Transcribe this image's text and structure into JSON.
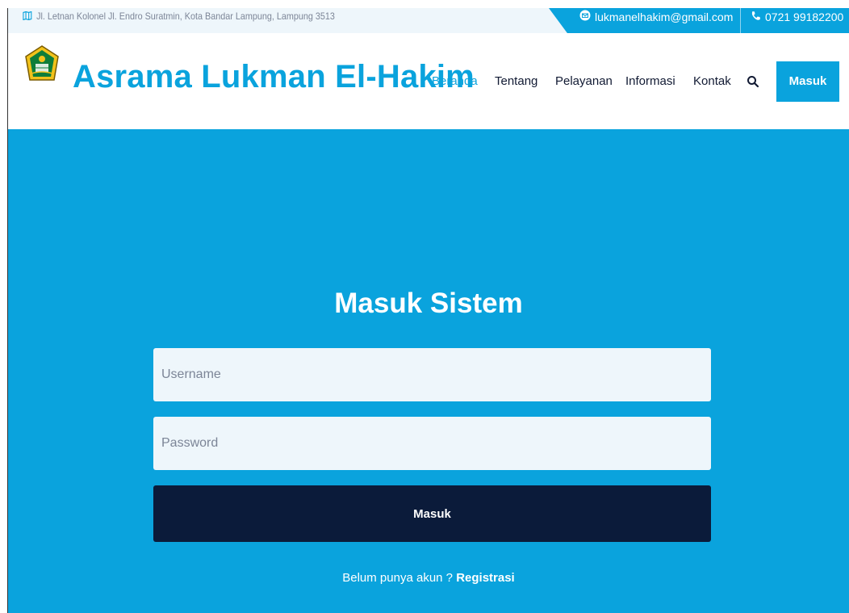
{
  "topbar": {
    "address": "Jl. Letnan Kolonel Jl. Endro Suratmin, Kota Bandar Lampung, Lampung 3513",
    "email": "lukmanelhakim@gmail.com",
    "phone": "0721 99182200"
  },
  "header": {
    "brand": "Asrama Lukman El-Hakim",
    "nav": {
      "beranda": "Beranda",
      "tentang": "Tentang",
      "pelayanan": "Pelayanan",
      "informasi": "Informasi",
      "kontak": "Kontak"
    },
    "login_button": "Masuk"
  },
  "login": {
    "title": "Masuk Sistem",
    "username_placeholder": "Username",
    "password_placeholder": "Password",
    "submit_label": "Masuk",
    "register_prompt": "Belum punya akun ? ",
    "register_link": "Registrasi"
  },
  "colors": {
    "accent": "#0aa3dd",
    "dark_button": "#0b1b3a",
    "input_bg": "#eef6fb"
  },
  "icons": {
    "address": "map-icon",
    "email": "envelope-icon",
    "phone": "phone-icon",
    "search": "search-icon",
    "logo": "ministry-emblem-logo"
  }
}
